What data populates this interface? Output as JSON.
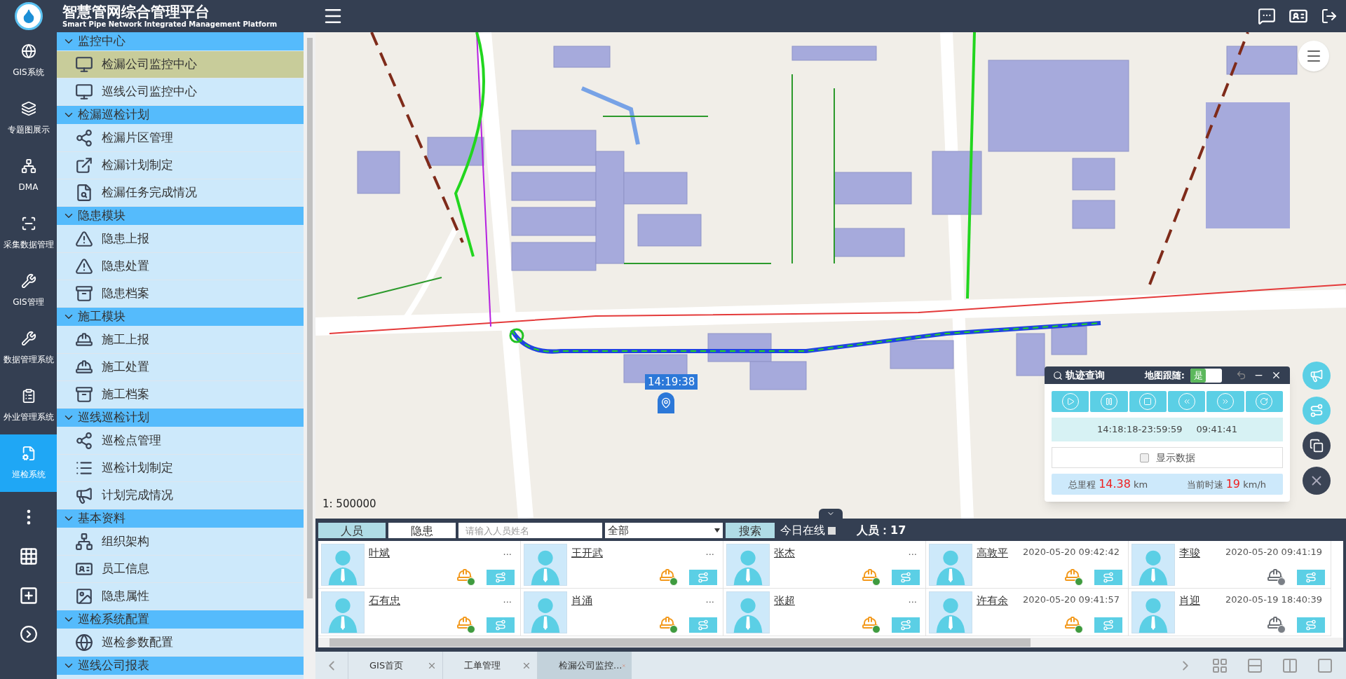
{
  "app": {
    "title": "智慧管网综合管理平台",
    "subtitle": "Smart Pipe Network Integrated Management Platform"
  },
  "rail": {
    "items": [
      {
        "label": "GIS系统",
        "selected": false
      },
      {
        "label": "专题图展示",
        "selected": false
      },
      {
        "label": "DMA",
        "selected": false
      },
      {
        "label": "采集数据管理",
        "selected": false
      },
      {
        "label": "GIS管理",
        "selected": false
      },
      {
        "label": "数据管理系统",
        "selected": false
      },
      {
        "label": "外业管理系统",
        "selected": false
      },
      {
        "label": "巡检系统",
        "selected": true
      }
    ]
  },
  "sidebar": {
    "groups": [
      {
        "label": "监控中心",
        "expanded": true,
        "items": [
          {
            "label": "检漏公司监控中心",
            "selected": true
          },
          {
            "label": "巡线公司监控中心",
            "selected": false
          }
        ]
      },
      {
        "label": "检漏巡检计划",
        "expanded": true,
        "items": [
          {
            "label": "检漏片区管理",
            "selected": false
          },
          {
            "label": "检漏计划制定",
            "selected": false
          },
          {
            "label": "检漏任务完成情况",
            "selected": false
          }
        ]
      },
      {
        "label": "隐患模块",
        "expanded": true,
        "items": [
          {
            "label": "隐患上报",
            "selected": false
          },
          {
            "label": "隐患处置",
            "selected": false
          },
          {
            "label": "隐患档案",
            "selected": false
          }
        ]
      },
      {
        "label": "施工模块",
        "expanded": true,
        "items": [
          {
            "label": "施工上报",
            "selected": false
          },
          {
            "label": "施工处置",
            "selected": false
          },
          {
            "label": "施工档案",
            "selected": false
          }
        ]
      },
      {
        "label": "巡线巡检计划",
        "expanded": true,
        "items": [
          {
            "label": "巡检点管理",
            "selected": false
          },
          {
            "label": "巡检计划制定",
            "selected": false
          },
          {
            "label": "计划完成情况",
            "selected": false
          }
        ]
      },
      {
        "label": "基本资料",
        "expanded": true,
        "items": [
          {
            "label": "组织架构",
            "selected": false
          },
          {
            "label": "员工信息",
            "selected": false
          },
          {
            "label": "隐患属性",
            "selected": false
          }
        ]
      },
      {
        "label": "巡检系统配置",
        "expanded": true,
        "items": [
          {
            "label": "巡检参数配置",
            "selected": false
          }
        ]
      },
      {
        "label": "巡线公司报表",
        "expanded": true
      }
    ]
  },
  "map": {
    "scale": "1: 500000",
    "marker_time": "14:19:38"
  },
  "track_panel": {
    "title": "轨迹查询",
    "follow_label": "地图跟随:",
    "follow": {
      "label": "是",
      "on": true
    },
    "time_range": "14:18:18-23:59:59",
    "elapsed": "09:41:41",
    "show_data": {
      "label": "显示数据",
      "checked": false
    },
    "distance": {
      "label": "总里程",
      "value": "14.38",
      "unit": "km"
    },
    "speed": {
      "label": "当前时速",
      "value": "19",
      "unit": "km/h"
    }
  },
  "people_panel": {
    "tabs": [
      {
        "label": "人员",
        "selected": true
      },
      {
        "label": "隐患",
        "selected": false
      }
    ],
    "search": {
      "placeholder": "请输入人员姓名"
    },
    "filter": {
      "value": "全部"
    },
    "search_button": "搜索",
    "online_today": {
      "label": "今日在线",
      "checked": false
    },
    "count_label": "人员：",
    "count": "17",
    "rows": [
      [
        {
          "name": "叶斌",
          "time": "...",
          "online": true
        },
        {
          "name": "王开武",
          "time": "...",
          "online": true
        },
        {
          "name": "张杰",
          "time": "...",
          "online": true
        },
        {
          "name": "高敦平",
          "time": "2020-05-20 09:42:42",
          "online": true
        },
        {
          "name": "李骏",
          "time": "2020-05-20 09:41:19",
          "online": false
        }
      ],
      [
        {
          "name": "石有忠",
          "time": "...",
          "online": true
        },
        {
          "name": "肖涌",
          "time": "...",
          "online": true
        },
        {
          "name": "张超",
          "time": "...",
          "online": true
        },
        {
          "name": "许有余",
          "time": "2020-05-20 09:41:57",
          "online": true
        },
        {
          "name": "肖迎",
          "time": "2020-05-19 18:40:39",
          "online": false
        }
      ]
    ]
  },
  "tab_bar": {
    "tabs": [
      {
        "label": "GIS首页",
        "selected": false
      },
      {
        "label": "工单管理",
        "selected": false
      },
      {
        "label": "检漏公司监控...",
        "selected": true
      }
    ]
  }
}
